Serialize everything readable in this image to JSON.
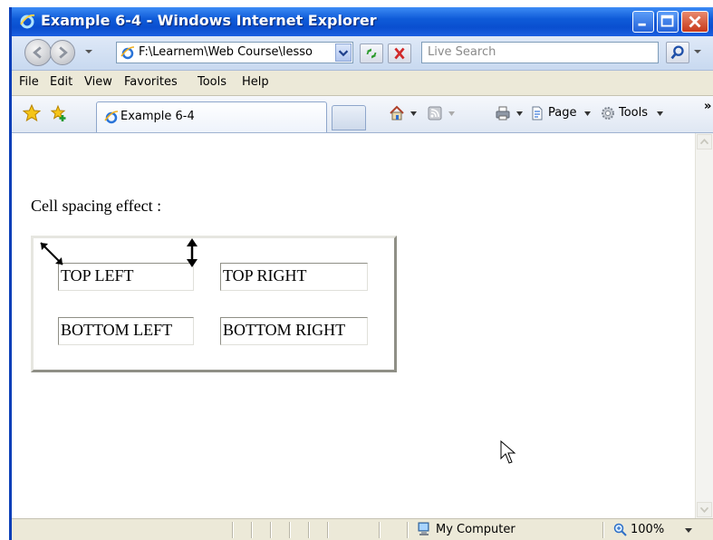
{
  "window": {
    "title": "Example 6-4 - Windows Internet Explorer"
  },
  "address": {
    "url": "F:\\Learnem\\Web Course\\lesso",
    "search_placeholder": "Live Search"
  },
  "menu": [
    "File",
    "Edit",
    "View",
    "Favorites",
    "Tools",
    "Help"
  ],
  "tab": {
    "title": "Example 6-4"
  },
  "toolbar": {
    "page_label": "Page",
    "tools_label": "Tools"
  },
  "content": {
    "heading": "Cell spacing effect :",
    "table": [
      [
        "TOP LEFT",
        "TOP RIGHT"
      ],
      [
        "BOTTOM LEFT",
        "BOTTOM RIGHT"
      ]
    ]
  },
  "status": {
    "zone": "My Computer",
    "zoom": "100%"
  },
  "colors": {
    "titlebar": "#0a4fd0",
    "chrome": "#ece9d8"
  }
}
